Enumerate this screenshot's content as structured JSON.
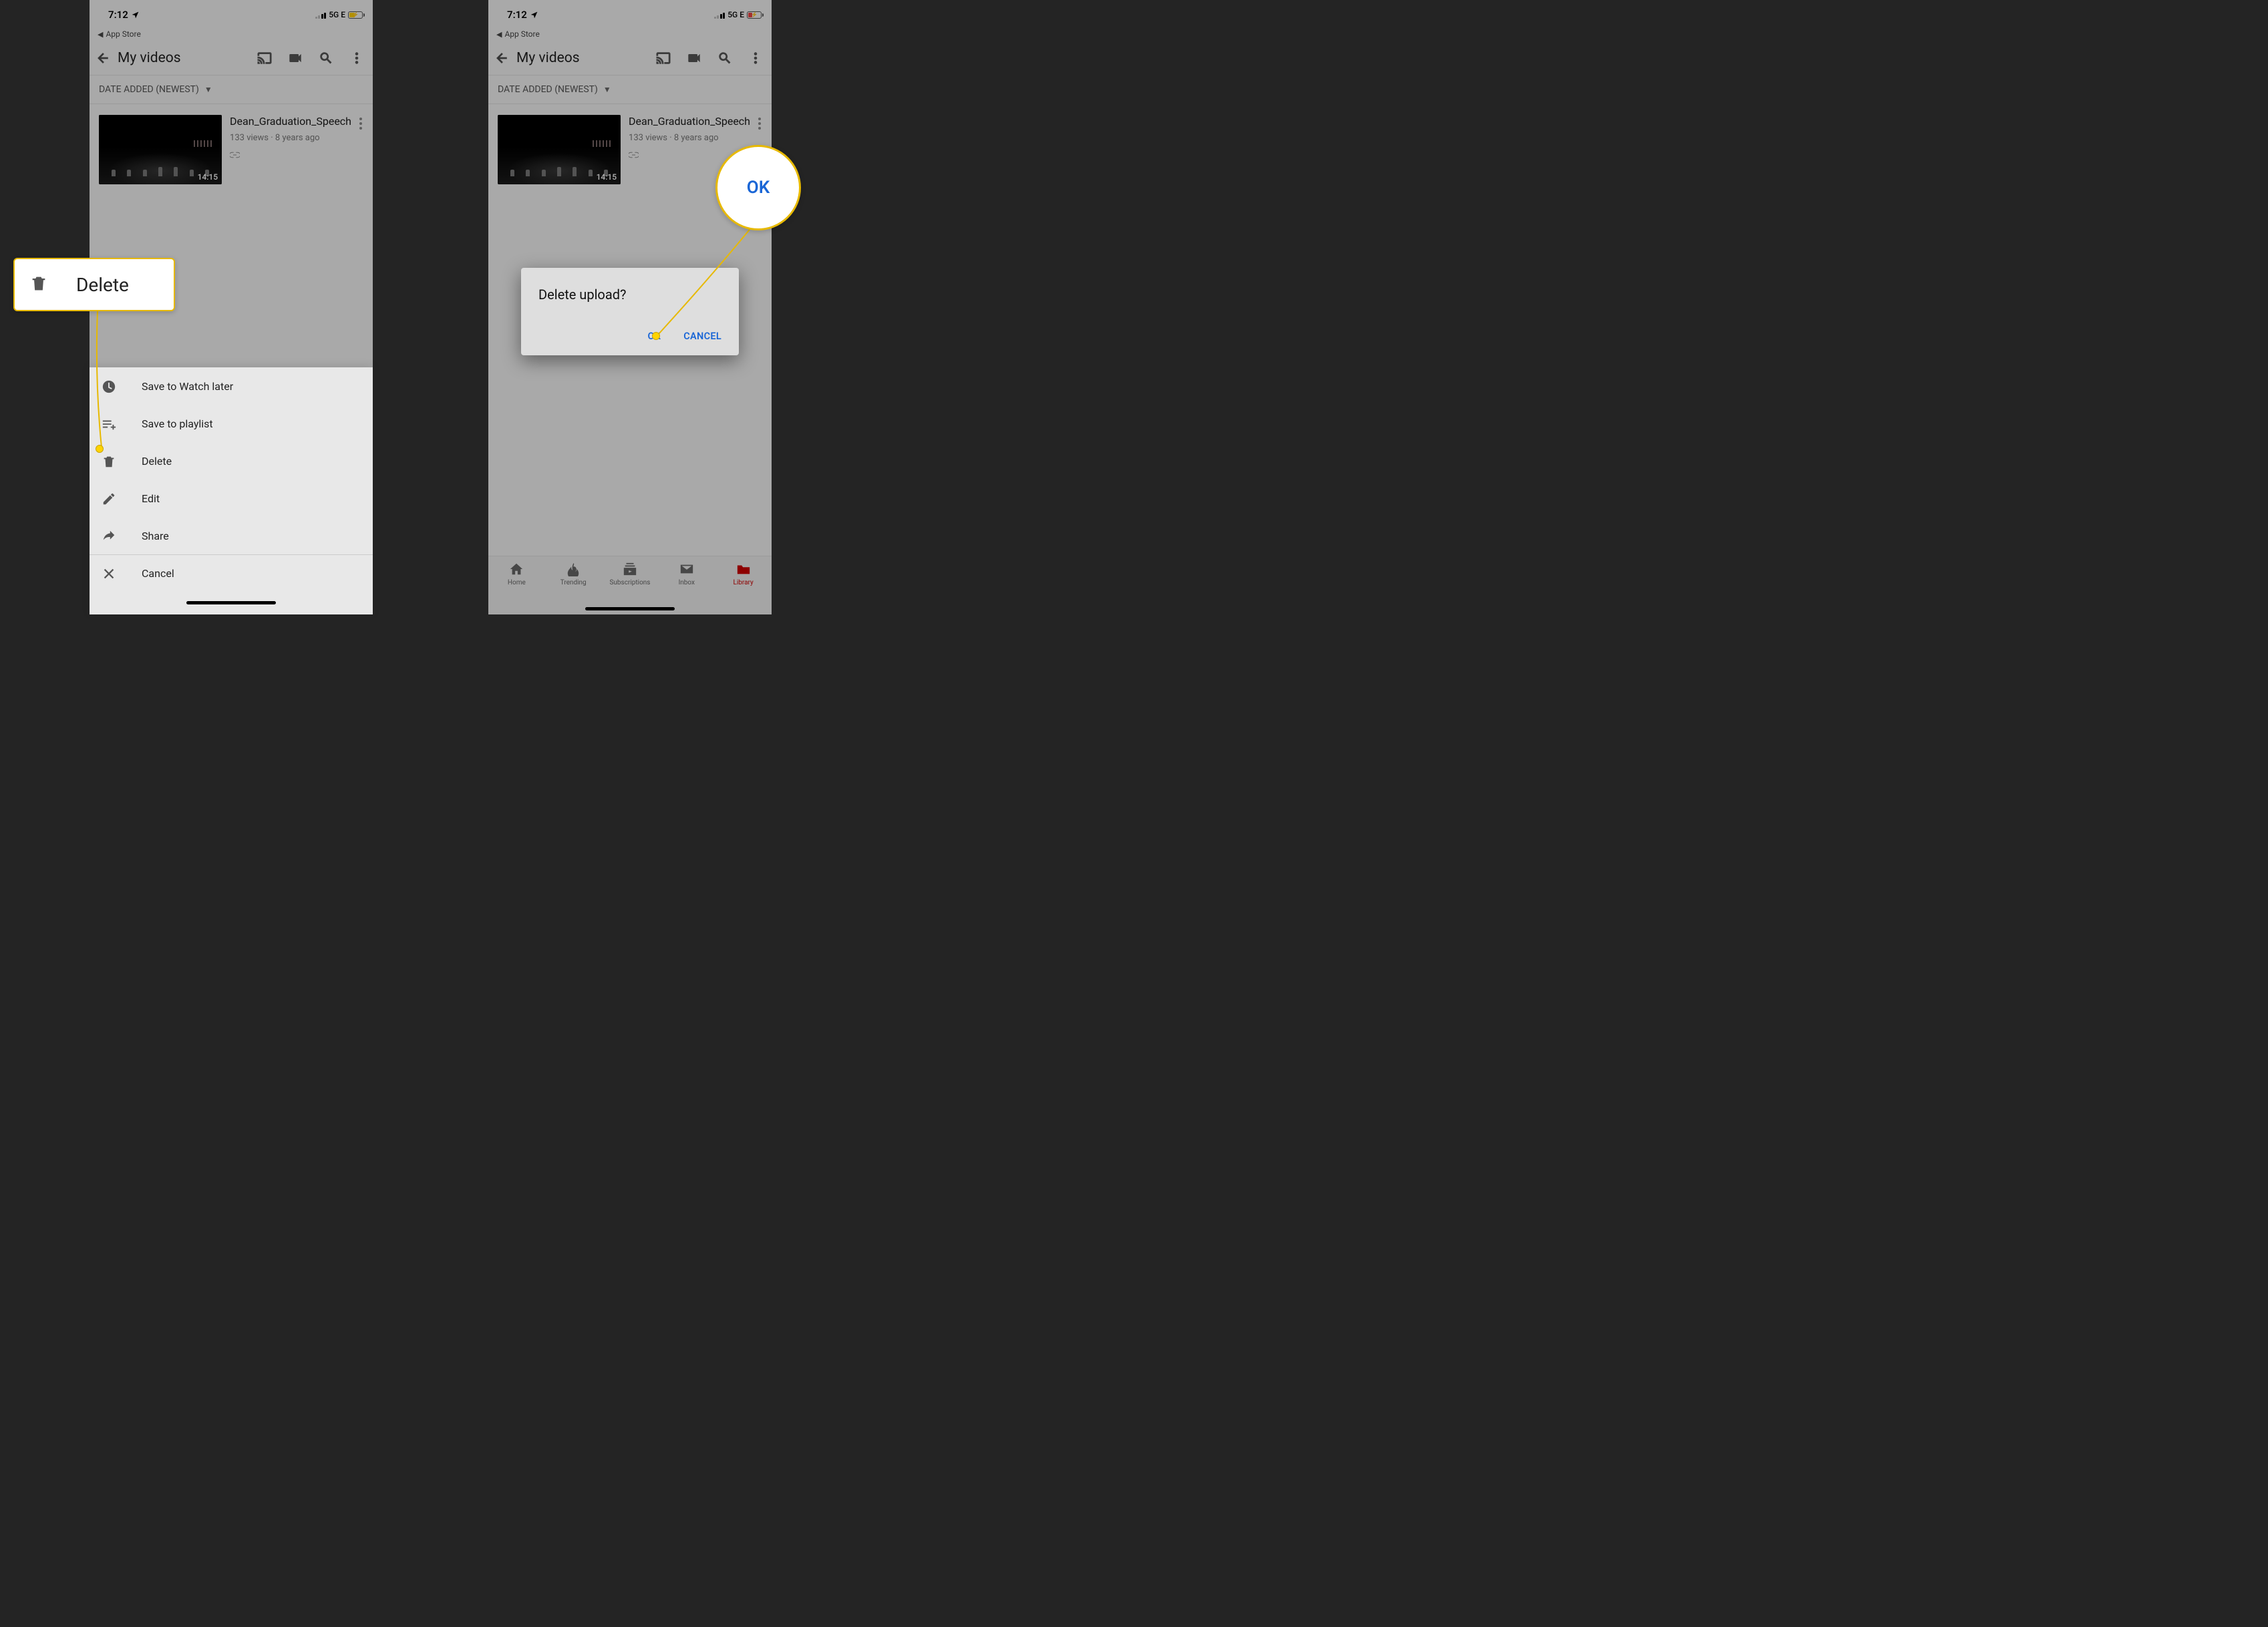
{
  "status": {
    "time": "7:12",
    "back_to": "App Store",
    "network": "5G E"
  },
  "header": {
    "title": "My videos"
  },
  "sort": {
    "label": "DATE ADDED (NEWEST)"
  },
  "video": {
    "title": "Dean_Graduation_Speech",
    "views": "133 views",
    "age": "8 years ago",
    "duration": "14:15"
  },
  "sheet": {
    "watch_later": "Save to Watch later",
    "playlist": "Save to playlist",
    "delete": "Delete",
    "edit": "Edit",
    "share": "Share",
    "cancel": "Cancel"
  },
  "callout": {
    "delete": "Delete",
    "ok": "OK"
  },
  "dialog": {
    "title": "Delete upload?",
    "ok": "OK",
    "cancel": "CANCEL"
  },
  "tabs": {
    "home": "Home",
    "trending": "Trending",
    "subs": "Subscriptions",
    "inbox": "Inbox",
    "library": "Library"
  }
}
